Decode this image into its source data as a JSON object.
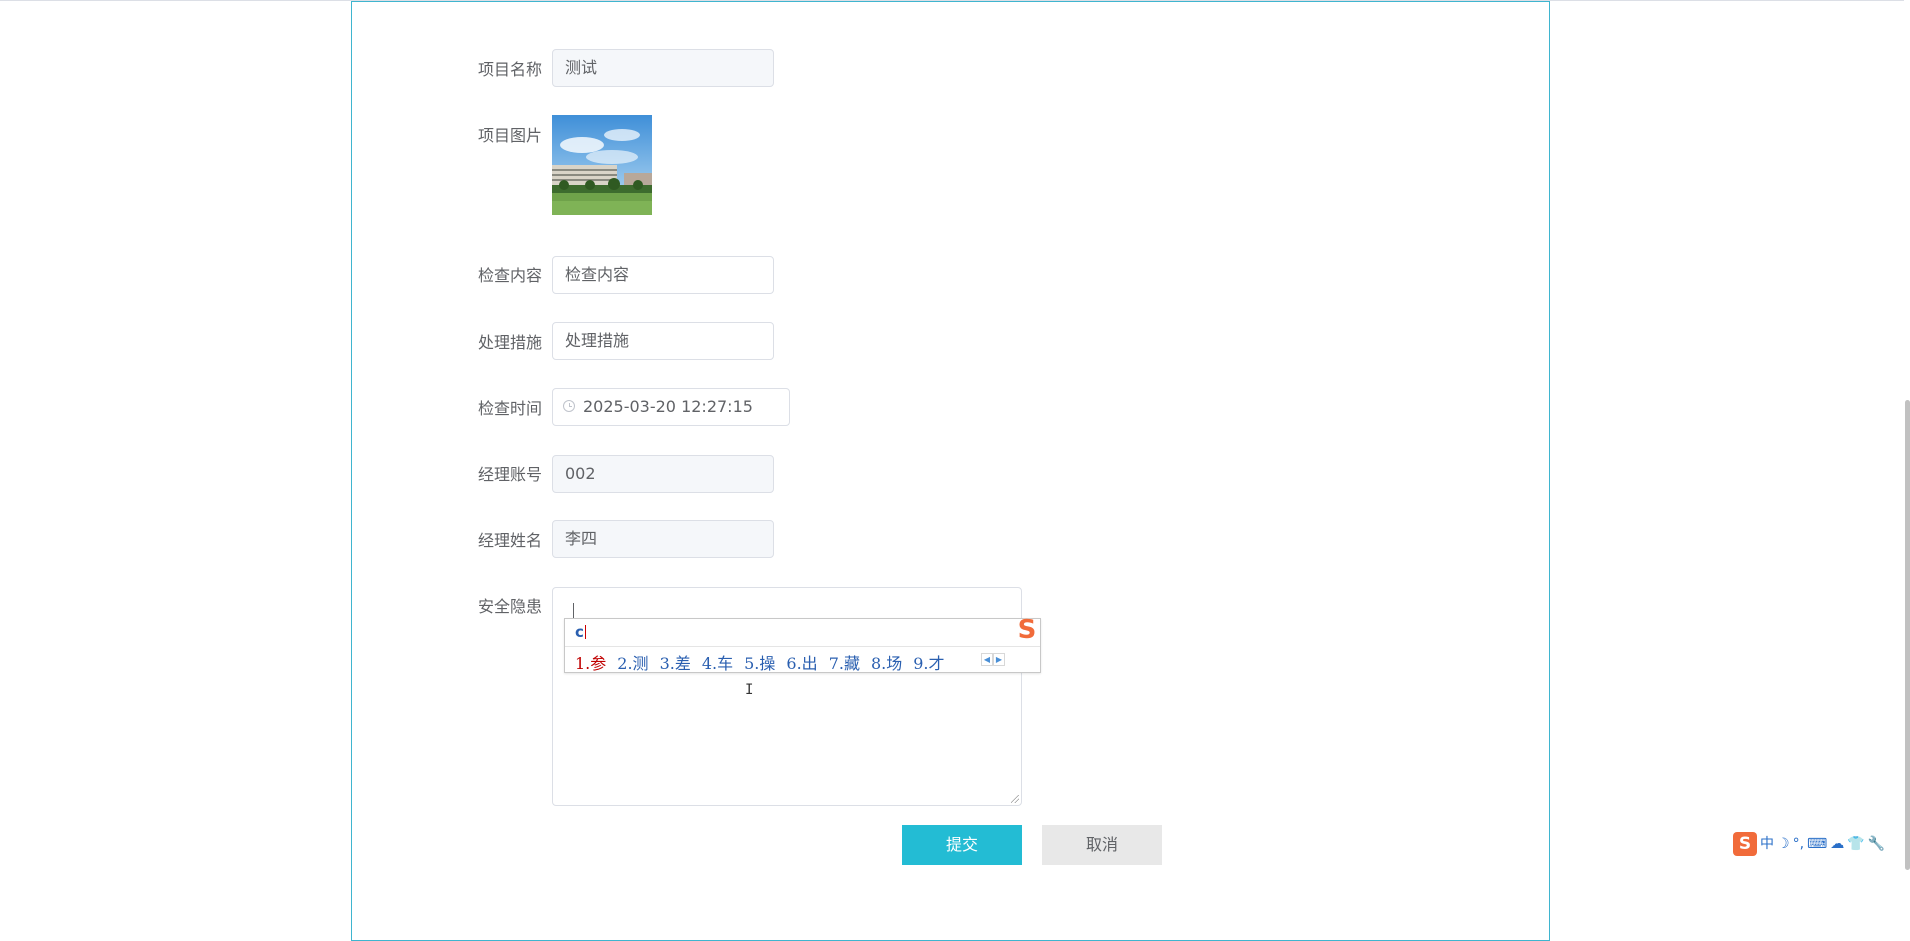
{
  "form": {
    "project_name": {
      "label": "项目名称",
      "value": "测试"
    },
    "project_image": {
      "label": "项目图片"
    },
    "inspection_content": {
      "label": "检查内容",
      "placeholder": "检查内容"
    },
    "measures": {
      "label": "处理措施",
      "placeholder": "处理措施"
    },
    "inspection_time": {
      "label": "检查时间",
      "value": "2025-03-20 12:27:15"
    },
    "manager_account": {
      "label": "经理账号",
      "value": "002"
    },
    "manager_name": {
      "label": "经理姓名",
      "value": "李四"
    },
    "hazard": {
      "label": "安全隐患",
      "value": ""
    }
  },
  "ime": {
    "pinyin": "c",
    "candidates": [
      "1.参",
      "2.测",
      "3.差",
      "4.车",
      "5.操",
      "6.出",
      "7.藏",
      "8.场",
      "9.才"
    ],
    "logo": "S",
    "status_bar": [
      "中",
      "☽",
      "°,",
      "⌨",
      "☁",
      "👕",
      "🔧"
    ]
  },
  "buttons": {
    "submit": "提交",
    "cancel": "取消"
  },
  "colors": {
    "accent": "#23bcd4",
    "panel_border": "#3fb5cf",
    "ime_orange": "#f16b3a"
  }
}
